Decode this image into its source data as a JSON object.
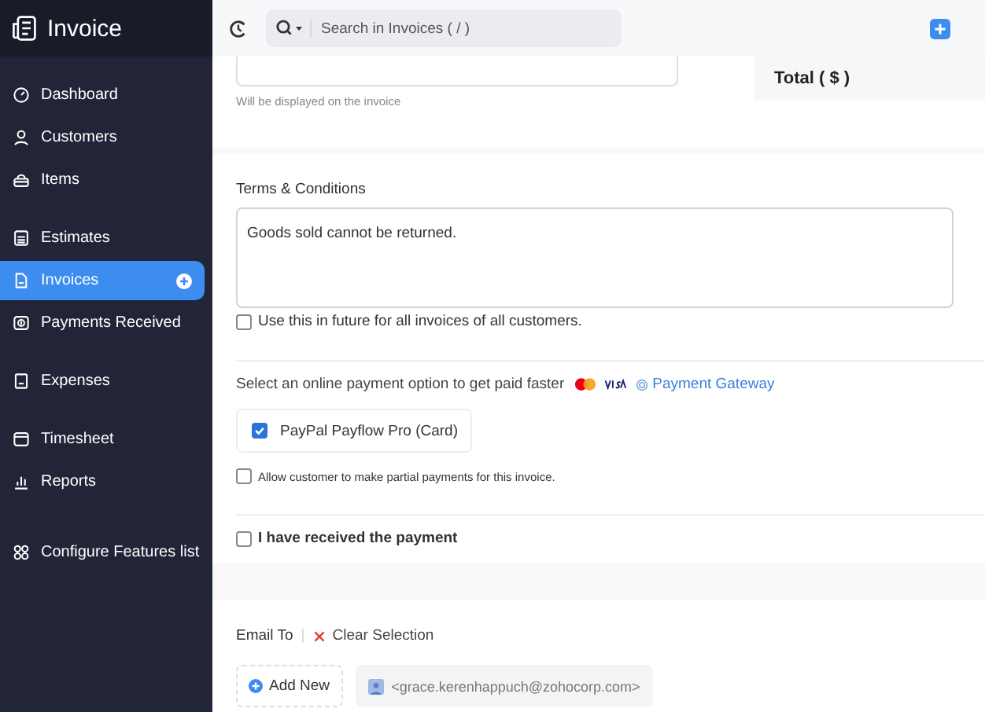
{
  "app": {
    "title": "Invoice"
  },
  "sidebar": {
    "items": [
      {
        "label": "Dashboard",
        "selected": false
      },
      {
        "label": "Customers",
        "selected": false
      },
      {
        "label": "Items",
        "selected": false
      },
      {
        "label": "Estimates",
        "selected": false
      },
      {
        "label": "Invoices",
        "selected": true
      },
      {
        "label": "Payments Received",
        "selected": false
      },
      {
        "label": "Expenses",
        "selected": false
      },
      {
        "label": "Timesheet",
        "selected": false
      },
      {
        "label": "Reports",
        "selected": false
      },
      {
        "label": "Configure Features list",
        "selected": false
      }
    ]
  },
  "topbar": {
    "search_placeholder": "Search in Invoices ( / )"
  },
  "notes": {
    "hint": "Will be displayed on the invoice"
  },
  "total": {
    "label": "Total ( $ )"
  },
  "terms": {
    "label": "Terms & Conditions",
    "value": "Goods sold cannot be returned.",
    "use_in_future": {
      "label": "Use this in future for all invoices of all customers.",
      "checked": false
    }
  },
  "payment": {
    "prompt": "Select an online payment option to get paid faster",
    "gateway_link": "Payment Gateway",
    "options": [
      {
        "label": "PayPal Payflow Pro (Card)",
        "checked": true
      }
    ],
    "partial": {
      "label": "Allow customer to make partial payments for this invoice.",
      "checked": false
    }
  },
  "received": {
    "label": "I have received the payment",
    "checked": false
  },
  "email": {
    "label": "Email To",
    "clear": "Clear Selection",
    "add_new": "Add New",
    "recipients": [
      "<grace.kerenhappuch@zohocorp.com>"
    ]
  }
}
